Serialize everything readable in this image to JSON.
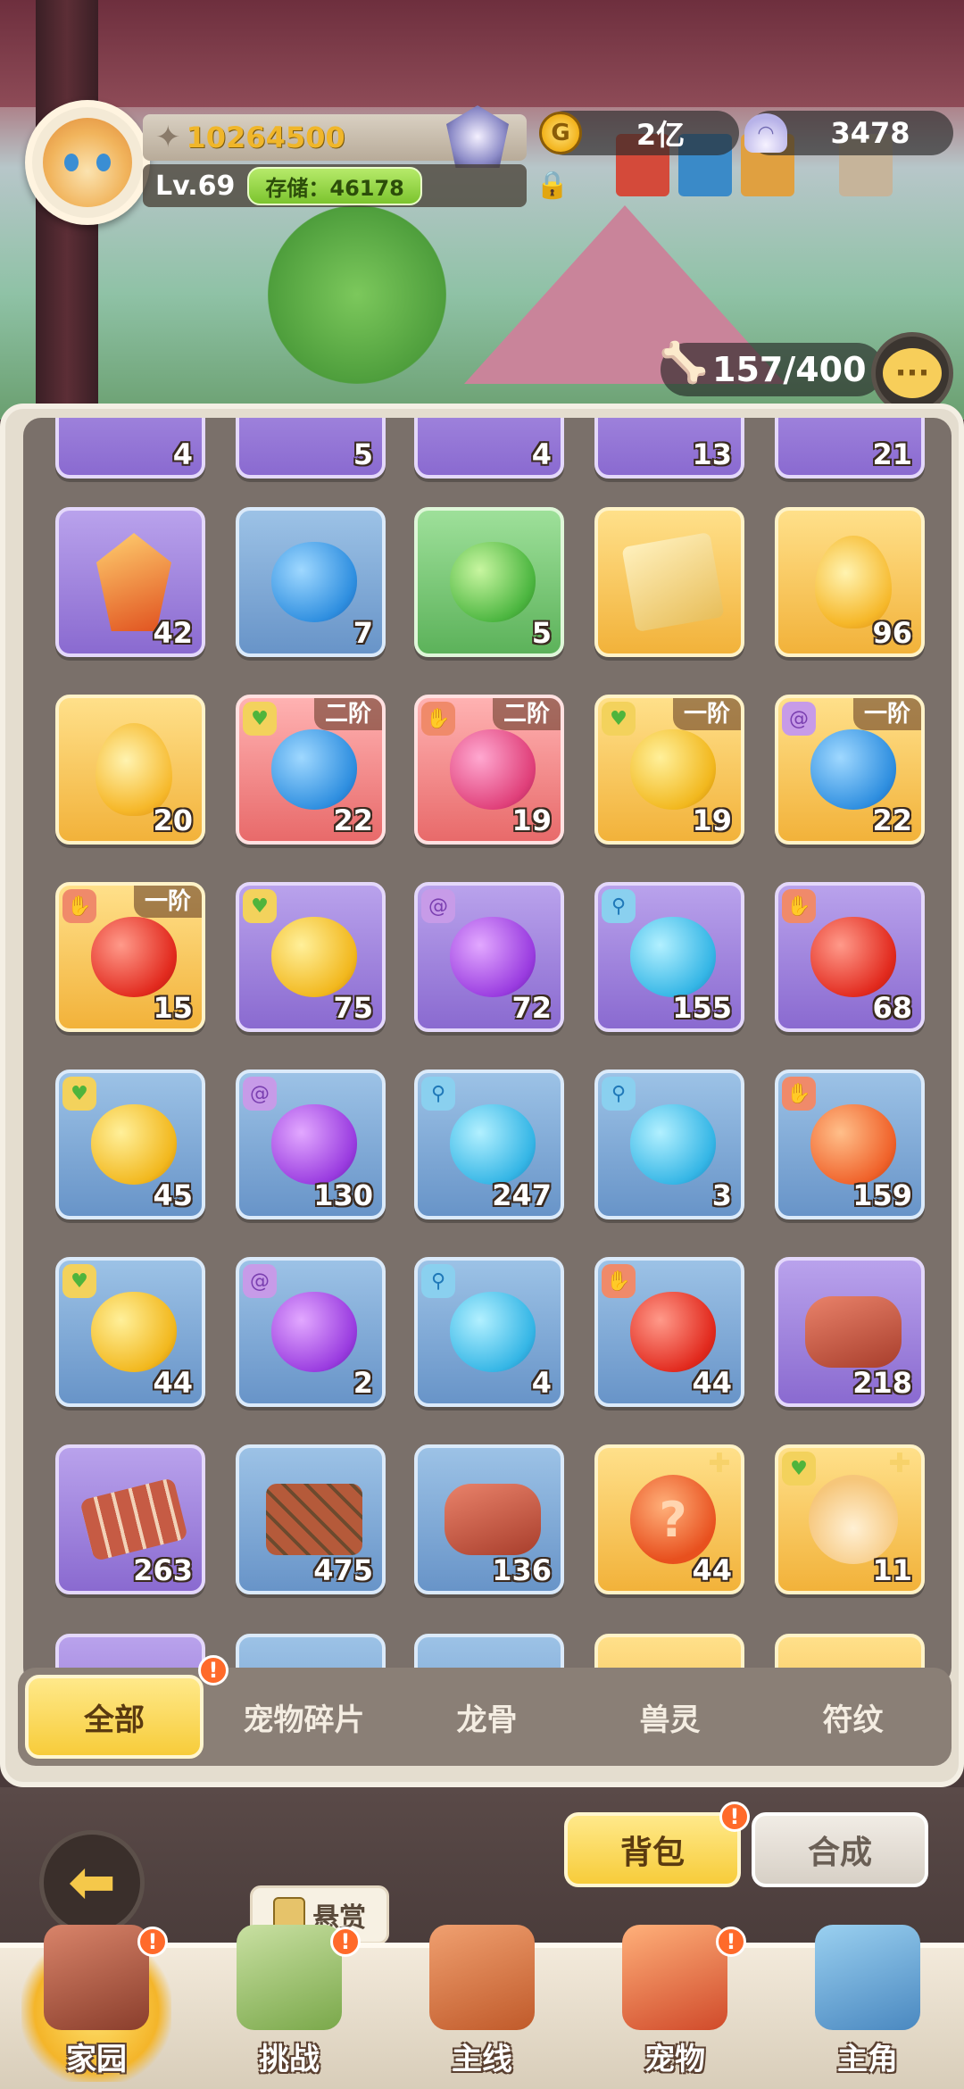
{
  "header": {
    "power": "10264500",
    "level": "Lv.69",
    "storage": "存储：46178",
    "gold": "2亿",
    "pearls": "3478",
    "capacity": "157/400"
  },
  "partial_top_counts": [
    "4",
    "5",
    "4",
    "13",
    "21"
  ],
  "items": [
    {
      "rarity": "purple",
      "art": "crystal",
      "count": "42"
    },
    {
      "rarity": "blue",
      "art": "blue-orb",
      "count": "7"
    },
    {
      "rarity": "green",
      "art": "green-orb",
      "count": "5"
    },
    {
      "rarity": "gold",
      "art": "scroll",
      "count": ""
    },
    {
      "rarity": "gold",
      "art": "egg",
      "count": "96"
    },
    {
      "rarity": "gold",
      "art": "egg",
      "count": "20"
    },
    {
      "rarity": "red",
      "art": "blue-fruit",
      "count": "22",
      "tier": "二阶",
      "elem": "e-heart"
    },
    {
      "rarity": "red",
      "art": "pink-fruit",
      "count": "19",
      "tier": "二阶",
      "elem": "e-claw"
    },
    {
      "rarity": "gold",
      "art": "yellow-fruit",
      "count": "19",
      "tier": "一阶",
      "elem": "e-heart"
    },
    {
      "rarity": "gold",
      "art": "blue-fruit",
      "count": "22",
      "tier": "一阶",
      "elem": "e-spiral"
    },
    {
      "rarity": "gold",
      "art": "red-fruit",
      "count": "15",
      "tier": "一阶",
      "elem": "e-claw"
    },
    {
      "rarity": "purple",
      "art": "yellow-fruit",
      "count": "75",
      "elem": "e-heart"
    },
    {
      "rarity": "purple",
      "art": "purple-fruit",
      "count": "72",
      "elem": "e-spiral"
    },
    {
      "rarity": "purple",
      "art": "cyan-fruit",
      "count": "155",
      "elem": "e-key"
    },
    {
      "rarity": "purple",
      "art": "red-fruit",
      "count": "68",
      "elem": "e-claw"
    },
    {
      "rarity": "blue",
      "art": "yellow-fruit",
      "count": "45",
      "elem": "e-heart"
    },
    {
      "rarity": "blue",
      "art": "purple-fruit",
      "count": "130",
      "elem": "e-spiral"
    },
    {
      "rarity": "blue",
      "art": "cyan-fruit",
      "count": "247",
      "elem": "e-key"
    },
    {
      "rarity": "blue",
      "art": "cyan-fruit",
      "count": "3",
      "elem": "e-key"
    },
    {
      "rarity": "blue",
      "art": "orange-fruit",
      "count": "159",
      "elem": "e-claw"
    },
    {
      "rarity": "blue",
      "art": "yellow-fruit",
      "count": "44",
      "elem": "e-heart"
    },
    {
      "rarity": "blue",
      "art": "purple-fruit",
      "count": "2",
      "elem": "e-spiral"
    },
    {
      "rarity": "blue",
      "art": "cyan-fruit",
      "count": "4",
      "elem": "e-key"
    },
    {
      "rarity": "blue",
      "art": "red-fruit",
      "count": "44",
      "elem": "e-claw"
    },
    {
      "rarity": "purple",
      "art": "meat",
      "count": "218"
    },
    {
      "rarity": "purple",
      "art": "ribs",
      "count": "263"
    },
    {
      "rarity": "blue",
      "art": "skewer",
      "count": "475"
    },
    {
      "rarity": "blue",
      "art": "meat",
      "count": "136"
    },
    {
      "rarity": "gold",
      "art": "egg-q",
      "count": "44",
      "puzzle": true
    },
    {
      "rarity": "gold",
      "art": "pet-face",
      "count": "11",
      "puzzle": true,
      "elem": "e-heart"
    }
  ],
  "tabs": [
    {
      "label": "全部",
      "active": true
    },
    {
      "label": "宠物碎片"
    },
    {
      "label": "龙骨"
    },
    {
      "label": "兽灵"
    },
    {
      "label": "符纹"
    }
  ],
  "badge_symbol": "!",
  "buttons": {
    "bag": "背包",
    "merge": "合成",
    "bounty": "悬赏"
  },
  "nav": [
    {
      "label": "家园",
      "active": true,
      "badge": true
    },
    {
      "label": "挑战",
      "badge": true
    },
    {
      "label": "主线"
    },
    {
      "label": "宠物",
      "badge": true
    },
    {
      "label": "主角"
    }
  ],
  "colors": {
    "accent_gold": "#f7cc3a",
    "badge": "#ff6a2a"
  }
}
